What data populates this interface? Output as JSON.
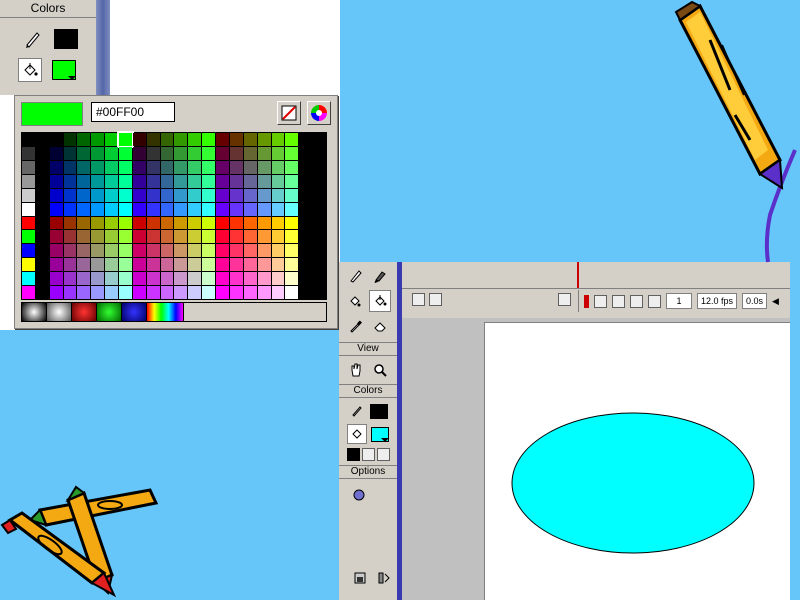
{
  "colors": {
    "background": "#66c6fa",
    "toolbar": "#d4d0c8",
    "selected_fill": "#00ff00",
    "stroke": "#000000",
    "ellipse_fill": "#00ffff"
  },
  "top_panel": {
    "colors_header": "Colors",
    "stroke_icon": "pencil-icon",
    "fill_icon": "paint-bucket-icon",
    "hex_value": "#00FF00",
    "no_color_icon": "no-color-icon",
    "color_wheel_icon": "color-wheel-icon"
  },
  "bottom_panel": {
    "view_header": "View",
    "colors_header": "Colors",
    "options_header": "Options",
    "frame": "1",
    "fps": "12.0 fps",
    "time": "0.0s"
  },
  "shape": {
    "type": "ellipse",
    "fill": "#00ffff",
    "stroke": "#000000"
  }
}
